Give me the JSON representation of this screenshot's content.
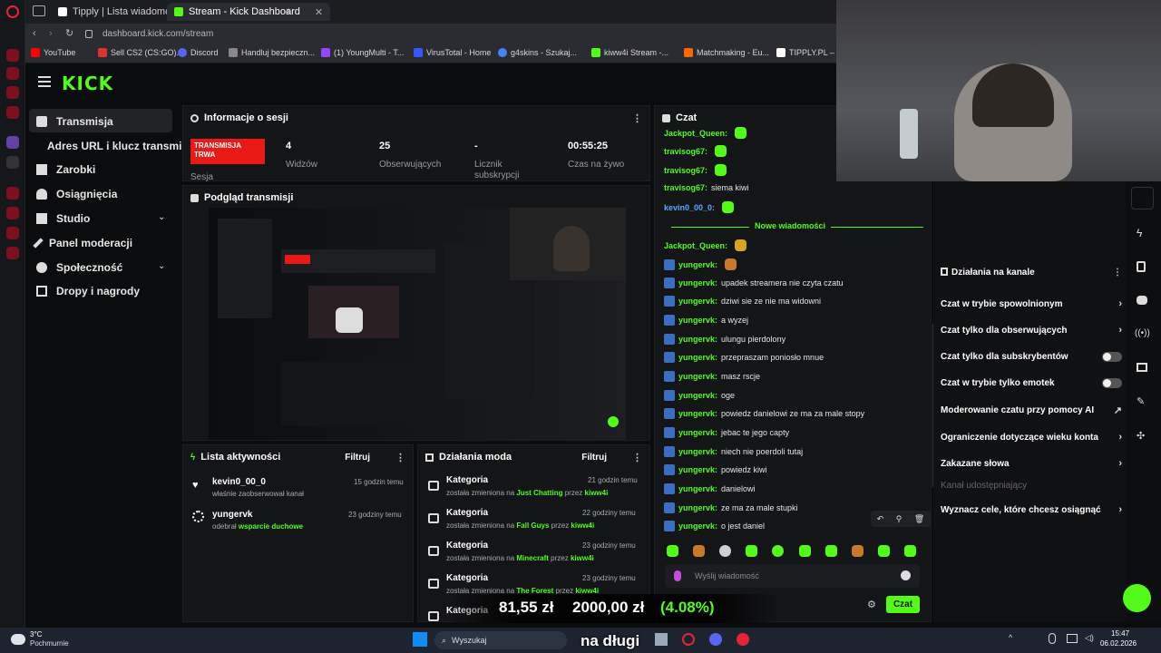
{
  "browser": {
    "tabs": [
      {
        "label": "Tipply | Lista wiadomości"
      },
      {
        "label": "Stream - Kick Dashboard"
      }
    ],
    "url": "dashboard.kick.com/stream",
    "bookmarks": [
      "YouTube",
      "Sell CS2 (CS:GO)...",
      "Discord",
      "Handluj bezpieczn...",
      "(1) YoungMulti - T...",
      "VirusTotal - Home",
      "g4skins - Szukaj...",
      "kiww4i Stream -...",
      "Matchmaking - Eu...",
      "TIPPLY.PL –"
    ]
  },
  "sidebar": {
    "logo": "KICK",
    "items": [
      {
        "label": "Transmisja"
      },
      {
        "label": "Adres URL i klucz transmisji"
      },
      {
        "label": "Zarobki"
      },
      {
        "label": "Osiągnięcia"
      },
      {
        "label": "Studio"
      },
      {
        "label": "Panel moderacji"
      },
      {
        "label": "Społeczność"
      },
      {
        "label": "Dropy i nagrody"
      }
    ]
  },
  "session": {
    "title": "Informacje o sesji",
    "live_badge": "TRANSMISJA TRWA",
    "session_label": "Sesja",
    "stats": [
      {
        "value": "4",
        "label": "Widzów"
      },
      {
        "value": "25",
        "label": "Obserwujących"
      },
      {
        "value": "-",
        "label": "Licznik subskrypcji"
      },
      {
        "value": "00:55:25",
        "label": "Czas na żywo"
      }
    ]
  },
  "preview": {
    "title": "Podgląd transmisji"
  },
  "activity": {
    "title": "Lista aktywności",
    "filter": "Filtruj",
    "items": [
      {
        "user": "kevin0_00_0",
        "text": "właśnie zaobserwował kanał",
        "time": "15 godzin temu"
      },
      {
        "user": "yungervk",
        "text_pre": "odebrał ",
        "text_hl": "wsparcie duchowe",
        "time": "23 godziny temu"
      }
    ]
  },
  "mod": {
    "title": "Działania moda",
    "filter": "Filtruj",
    "items": [
      {
        "cat": "Kategoria",
        "time": "21 godzin temu",
        "pre": "została zmieniona na ",
        "game": "Just Chatting",
        "by": " przez ",
        "mod": "kiww4i"
      },
      {
        "cat": "Kategoria",
        "time": "22 godziny temu",
        "pre": "została zmieniona na ",
        "game": "Fall Guys",
        "by": " przez ",
        "mod": "kiww4i"
      },
      {
        "cat": "Kategoria",
        "time": "23 godziny temu",
        "pre": "została zmieniona na ",
        "game": "Minecraft",
        "by": " przez ",
        "mod": "kiww4i"
      },
      {
        "cat": "Kategoria",
        "time": "23 godziny temu",
        "pre": "została zmieniona na ",
        "game": "The Forest",
        "by": " przez ",
        "mod": "kiww4i"
      },
      {
        "cat": "Kategoria"
      }
    ]
  },
  "chat": {
    "title": "Czat",
    "new_messages": "Nowe wiadomości",
    "messages": [
      {
        "user": "Jackpot_Queen:",
        "text": ""
      },
      {
        "user": "travisog67:",
        "text": ""
      },
      {
        "user": "travisog67:",
        "text": ""
      },
      {
        "user": "travisog67:",
        "text": "siema kiwi"
      },
      {
        "user": "kevin0_00_0:",
        "text": ""
      },
      {
        "user": "Jackpot_Queen:",
        "text": ""
      },
      {
        "user": "yungervk:",
        "text": ""
      },
      {
        "user": "yungervk:",
        "text": "upadek streamera nie czyta czatu"
      },
      {
        "user": "yungervk:",
        "text": "dziwi sie ze nie ma widowni"
      },
      {
        "user": "yungervk:",
        "text": "a wyzej"
      },
      {
        "user": "yungervk:",
        "text": "ulungu pierdolony"
      },
      {
        "user": "yungervk:",
        "text": "przepraszam poniosło mnue"
      },
      {
        "user": "yungervk:",
        "text": "masz rscje"
      },
      {
        "user": "yungervk:",
        "text": "oge"
      },
      {
        "user": "yungervk:",
        "text": "powiedz danielowi ze ma za male stopy"
      },
      {
        "user": "yungervk:",
        "text": "jebac te jego capty"
      },
      {
        "user": "yungervk:",
        "text": "niech nie poerdoli tutaj"
      },
      {
        "user": "yungervk:",
        "text": "powiedz kiwi"
      },
      {
        "user": "yungervk:",
        "text": "danielowi"
      },
      {
        "user": "yungervk:",
        "text": "ze ma za male stupki"
      },
      {
        "user": "yungervk:",
        "text": "o jest daniel"
      }
    ],
    "input_placeholder": "Wyślij wiadomość",
    "send": "Czat"
  },
  "channel": {
    "title": "Działania na kanale",
    "options": [
      {
        "label": "Czat w trybie spowolnionym",
        "kind": "chevron"
      },
      {
        "label": "Czat tylko dla obserwujących",
        "kind": "chevron"
      },
      {
        "label": "Czat tylko dla subskrybentów",
        "kind": "toggle"
      },
      {
        "label": "Czat w trybie tylko emotek",
        "kind": "toggle"
      },
      {
        "label": "Moderowanie czatu przy pomocy AI",
        "kind": "external"
      },
      {
        "label": "Ograniczenie dotyczące wieku konta",
        "kind": "chevron"
      },
      {
        "label": "Zakazane słowa",
        "kind": "chevron"
      },
      {
        "label": "Kanał udostępniający",
        "kind": "disabled"
      },
      {
        "label": "Wyznacz cele, które chcesz osiągnąć",
        "kind": "chevron"
      }
    ]
  },
  "overlay": {
    "donation": "81,55 zł",
    "goal": "2000,00 zł",
    "percent": "(4.08%)",
    "caption": "na długi"
  },
  "taskbar": {
    "weather_temp": "3°C",
    "weather_desc": "Pochmurnie",
    "search": "Wyszukaj",
    "time": "15:47",
    "date": "06.02.2026"
  }
}
